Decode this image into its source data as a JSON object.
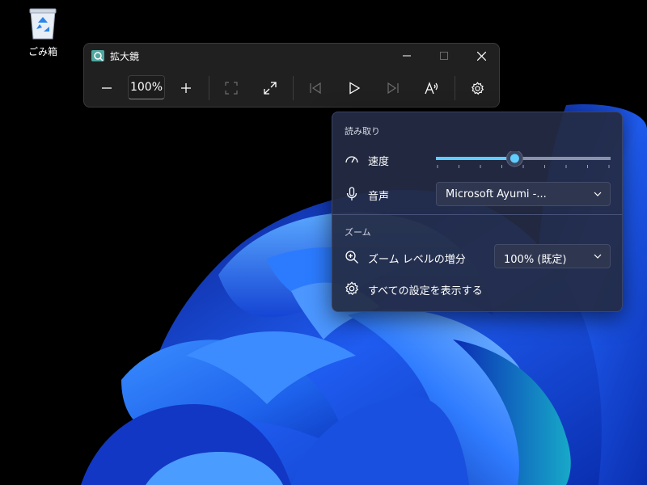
{
  "desktop": {
    "recycle_bin_label": "ごみ箱"
  },
  "magnifier": {
    "title": "拡大鏡",
    "zoom_value": "100%"
  },
  "reading_panel": {
    "reading_header": "読み取り",
    "speed_label": "速度",
    "speed_fraction": 0.45,
    "voice_label": "音声",
    "voice_value": "Microsoft Ayumi -...",
    "zoom_header": "ズーム",
    "zoom_increment_label": "ズーム レベルの増分",
    "zoom_increment_value": "100% (既定)",
    "all_settings_label": "すべての設定を表示する"
  },
  "colors": {
    "accent": "#60cdff",
    "panel_bg": "#232b44",
    "window_bg": "#202020"
  }
}
